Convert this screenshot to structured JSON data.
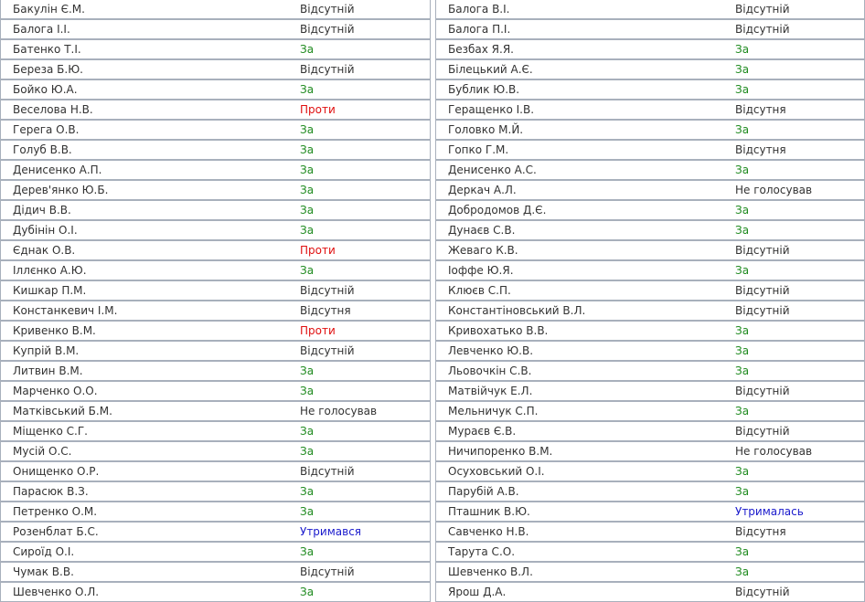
{
  "vote_colors": {
    "za": "#1e8a1e",
    "proty": "#e01010",
    "utrym": "#1a1acc",
    "other": "#333333"
  },
  "left_column": [
    {
      "name": "Бакулін Є.М.",
      "vote": "Відсутній",
      "type": "absent"
    },
    {
      "name": "Балога І.І.",
      "vote": "Відсутній",
      "type": "absent"
    },
    {
      "name": "Батенко Т.І.",
      "vote": "За",
      "type": "za"
    },
    {
      "name": "Береза Б.Ю.",
      "vote": "Відсутній",
      "type": "absent"
    },
    {
      "name": "Бойко Ю.А.",
      "vote": "За",
      "type": "za"
    },
    {
      "name": "Веселова Н.В.",
      "vote": "Проти",
      "type": "proty"
    },
    {
      "name": "Герега О.В.",
      "vote": "За",
      "type": "za"
    },
    {
      "name": "Голуб В.В.",
      "vote": "За",
      "type": "za"
    },
    {
      "name": "Денисенко А.П.",
      "vote": "За",
      "type": "za"
    },
    {
      "name": "Дерев'янко Ю.Б.",
      "vote": "За",
      "type": "za"
    },
    {
      "name": "Дідич В.В.",
      "vote": "За",
      "type": "za"
    },
    {
      "name": "Дубінін О.І.",
      "vote": "За",
      "type": "za"
    },
    {
      "name": "Єднак О.В.",
      "vote": "Проти",
      "type": "proty"
    },
    {
      "name": "Іллєнко А.Ю.",
      "vote": "За",
      "type": "za"
    },
    {
      "name": "Кишкар П.М.",
      "vote": "Відсутній",
      "type": "absent"
    },
    {
      "name": "Констанкевич І.М.",
      "vote": "Відсутня",
      "type": "absent"
    },
    {
      "name": "Кривенко В.М.",
      "vote": "Проти",
      "type": "proty"
    },
    {
      "name": "Купрій В.М.",
      "vote": "Відсутній",
      "type": "absent"
    },
    {
      "name": "Литвин В.М.",
      "vote": "За",
      "type": "za"
    },
    {
      "name": "Марченко О.О.",
      "vote": "За",
      "type": "za"
    },
    {
      "name": "Матківський Б.М.",
      "vote": "Не голосував",
      "type": "ne"
    },
    {
      "name": "Міщенко С.Г.",
      "vote": "За",
      "type": "za"
    },
    {
      "name": "Мусій О.С.",
      "vote": "За",
      "type": "za"
    },
    {
      "name": "Онищенко О.Р.",
      "vote": "Відсутній",
      "type": "absent"
    },
    {
      "name": "Парасюк В.З.",
      "vote": "За",
      "type": "za"
    },
    {
      "name": "Петренко О.М.",
      "vote": "За",
      "type": "za"
    },
    {
      "name": "Розенблат Б.С.",
      "vote": "Утримався",
      "type": "utrym"
    },
    {
      "name": "Сироїд О.І.",
      "vote": "За",
      "type": "za"
    },
    {
      "name": "Чумак В.В.",
      "vote": "Відсутній",
      "type": "absent"
    },
    {
      "name": "Шевченко О.Л.",
      "vote": "За",
      "type": "za"
    }
  ],
  "right_column": [
    {
      "name": "Балога В.І.",
      "vote": "Відсутній",
      "type": "absent"
    },
    {
      "name": "Балога П.І.",
      "vote": "Відсутній",
      "type": "absent"
    },
    {
      "name": "Безбах Я.Я.",
      "vote": "За",
      "type": "za"
    },
    {
      "name": "Білецький А.Є.",
      "vote": "За",
      "type": "za"
    },
    {
      "name": "Бублик Ю.В.",
      "vote": "За",
      "type": "za"
    },
    {
      "name": "Геращенко І.В.",
      "vote": "Відсутня",
      "type": "absent"
    },
    {
      "name": "Головко М.Й.",
      "vote": "За",
      "type": "za"
    },
    {
      "name": "Гопко Г.М.",
      "vote": "Відсутня",
      "type": "absent"
    },
    {
      "name": "Денисенко А.С.",
      "vote": "За",
      "type": "za"
    },
    {
      "name": "Деркач А.Л.",
      "vote": "Не голосував",
      "type": "ne"
    },
    {
      "name": "Добродомов Д.Є.",
      "vote": "За",
      "type": "za"
    },
    {
      "name": "Дунаєв С.В.",
      "vote": "За",
      "type": "za"
    },
    {
      "name": "Жеваго К.В.",
      "vote": "Відсутній",
      "type": "absent"
    },
    {
      "name": "Іоффе Ю.Я.",
      "vote": "За",
      "type": "za"
    },
    {
      "name": "Клюєв С.П.",
      "vote": "Відсутній",
      "type": "absent"
    },
    {
      "name": "Константіновський В.Л.",
      "vote": "Відсутній",
      "type": "absent"
    },
    {
      "name": "Кривохатько В.В.",
      "vote": "За",
      "type": "za"
    },
    {
      "name": "Левченко Ю.В.",
      "vote": "За",
      "type": "za"
    },
    {
      "name": "Льовочкін С.В.",
      "vote": "За",
      "type": "za"
    },
    {
      "name": "Матвійчук Е.Л.",
      "vote": "Відсутній",
      "type": "absent"
    },
    {
      "name": "Мельничук С.П.",
      "vote": "За",
      "type": "za"
    },
    {
      "name": "Мураєв Є.В.",
      "vote": "Відсутній",
      "type": "absent"
    },
    {
      "name": "Ничипоренко В.М.",
      "vote": "Не голосував",
      "type": "ne"
    },
    {
      "name": "Осуховський О.І.",
      "vote": "За",
      "type": "za"
    },
    {
      "name": "Парубій А.В.",
      "vote": "За",
      "type": "za"
    },
    {
      "name": "Пташник В.Ю.",
      "vote": "Утрималась",
      "type": "utrym"
    },
    {
      "name": "Савченко Н.В.",
      "vote": "Відсутня",
      "type": "absent"
    },
    {
      "name": "Тарута С.О.",
      "vote": "За",
      "type": "za"
    },
    {
      "name": "Шевченко В.Л.",
      "vote": "За",
      "type": "za"
    },
    {
      "name": "Ярош Д.А.",
      "vote": "Відсутній",
      "type": "absent"
    }
  ]
}
